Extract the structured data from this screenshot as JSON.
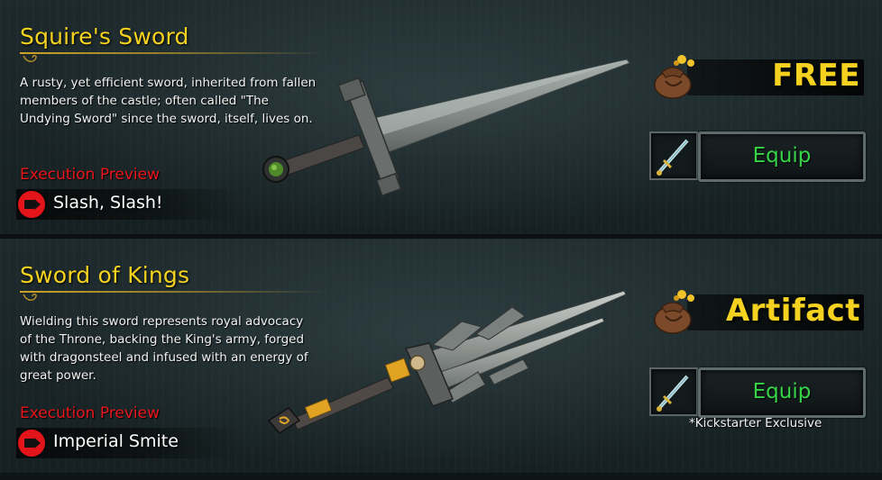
{
  "items": [
    {
      "title": "Squire's Sword",
      "description": "A rusty, yet efficient sword, inherited from fallen members of the castle; often called \"The Undying Sword\" since the sword, itself, lives on.",
      "execution_label": "Execution Preview",
      "execution_name": "Slash, Slash!",
      "price": "FREE",
      "equip_label": "Equip",
      "note": ""
    },
    {
      "title": "Sword of Kings",
      "description": "Wielding this sword represents royal advocacy of the Throne, backing the King's army, forged with dragonsteel and infused with an energy of great power.",
      "execution_label": "Execution Preview",
      "execution_name": "Imperial Smite",
      "price": "Artifact",
      "equip_label": "Equip",
      "note": "*Kickstarter Exclusive"
    }
  ],
  "colors": {
    "title": "#f4d21f",
    "execution_label": "#e8151b",
    "equip_text": "#37d649",
    "price_text": "#f4d21f"
  },
  "icons": [
    "camera-icon",
    "coin-bag-icon",
    "sword-thumbnail-icon",
    "squires-sword-image",
    "sword-of-kings-image"
  ]
}
